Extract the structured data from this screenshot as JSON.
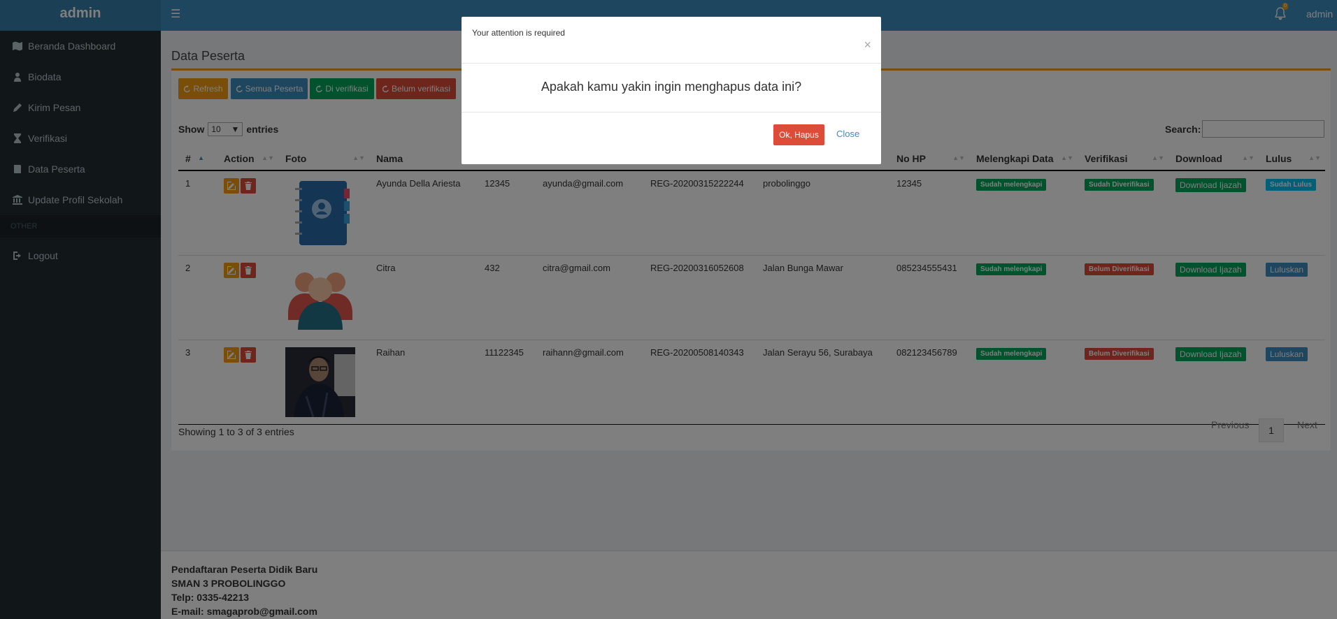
{
  "header": {
    "brand": "admin",
    "user": "admin",
    "notif_count": "0"
  },
  "sidebar": {
    "items": [
      {
        "label": "Beranda Dashboard",
        "icon": "map-icon"
      },
      {
        "label": "Biodata",
        "icon": "user-icon"
      },
      {
        "label": "Kirim Pesan",
        "icon": "pencil-icon"
      },
      {
        "label": "Verifikasi",
        "icon": "hourglass-icon"
      },
      {
        "label": "Data Peserta",
        "icon": "book-icon"
      },
      {
        "label": "Update Profil Sekolah",
        "icon": "bank-icon"
      }
    ],
    "other_header": "OTHER",
    "logout": "Logout"
  },
  "page": {
    "title": "Data Peserta"
  },
  "toolbar": {
    "refresh": "Refresh",
    "semua": "Semua Peserta",
    "diverifikasi": "Di verifikasi",
    "belum": "Belum verifikasi"
  },
  "table_controls": {
    "show": "Show",
    "entries_value": "10",
    "entries": "entries",
    "search": "Search:"
  },
  "columns": [
    "#",
    "Action",
    "Foto",
    "Nama",
    "",
    "",
    "",
    "",
    "No HP",
    "Melengkapi Data",
    "Verifikasi",
    "Download",
    "Lulus"
  ],
  "rows": [
    {
      "no": "1",
      "nama": "Ayunda Della Ariesta",
      "nisn": "12345",
      "email": "ayunda@gmail.com",
      "reg": "REG-20200315222244",
      "alamat": "probolinggo",
      "hp": "12345",
      "lengkap": "Sudah melengkapi",
      "verif": "Sudah Diverifikasi",
      "download": "Download Ijazah",
      "lulus": "Sudah Lulus"
    },
    {
      "no": "2",
      "nama": "Citra",
      "nisn": "432",
      "email": "citra@gmail.com",
      "reg": "REG-20200316052608",
      "alamat": "Jalan Bunga Mawar",
      "hp": "085234555431",
      "lengkap": "Sudah melengkapi",
      "verif": "Belum Diverifikasi",
      "download": "Download Ijazah",
      "lulus": "Luluskan"
    },
    {
      "no": "3",
      "nama": "Raihan",
      "nisn": "11122345",
      "email": "raihann@gmail.com",
      "reg": "REG-20200508140343",
      "alamat": "Jalan Serayu 56, Surabaya",
      "hp": "082123456789",
      "lengkap": "Sudah melengkapi",
      "verif": "Belum Diverifikasi",
      "download": "Download Ijazah",
      "lulus": "Luluskan"
    }
  ],
  "table_info": "Showing 1 to 3 of 3 entries",
  "pagination": {
    "previous": "Previous",
    "page": "1",
    "next": "Next"
  },
  "footer": {
    "line1": "Pendaftaran Peserta Didik Baru",
    "line2": "SMAN 3 PROBOLINGGO",
    "line3": "Telp: 0335-42213",
    "line4": "E-mail: smagaprob@gmail.com"
  },
  "modal": {
    "title": "Your attention is required",
    "message": "Apakah kamu yakin ingin menghapus data ini?",
    "ok": "Ok, Hapus",
    "close": "Close"
  },
  "colors": {
    "primary": "#3c8dbc",
    "warning": "#f39c12",
    "success": "#00a65a",
    "danger": "#dd4b39",
    "info": "#00c0ef",
    "sidebar": "#222d32"
  }
}
